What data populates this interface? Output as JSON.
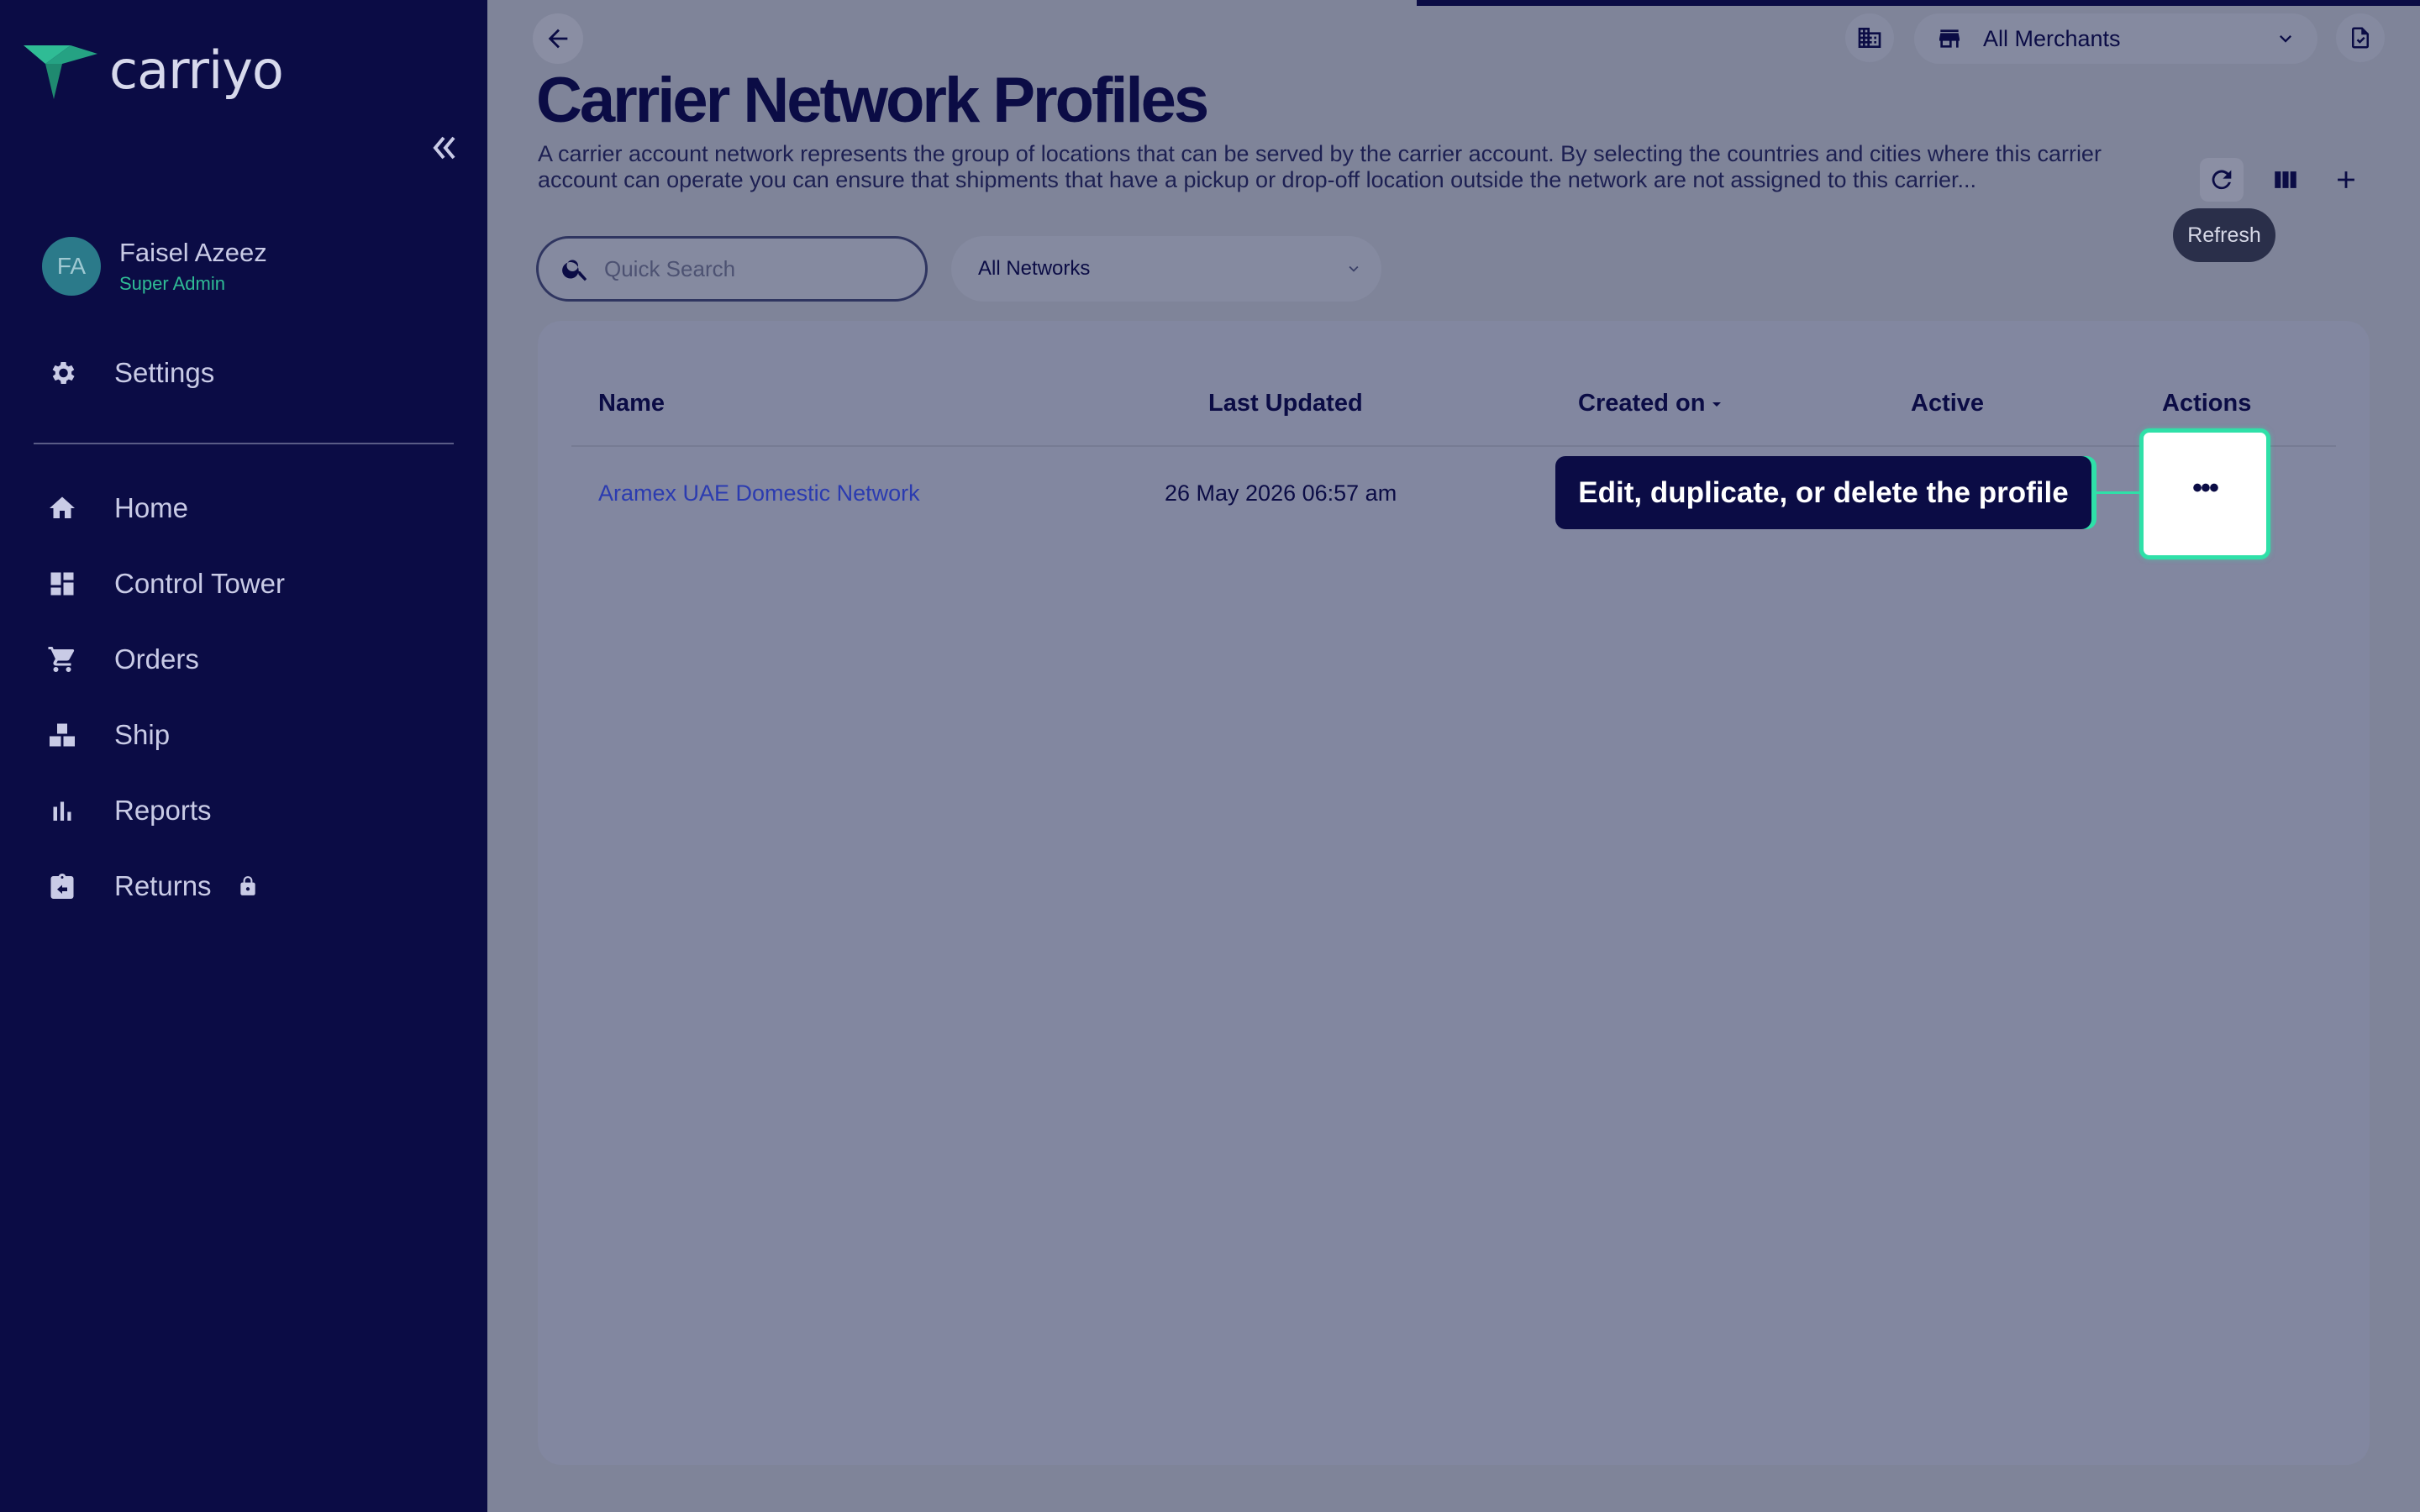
{
  "app": {
    "logo_text": "carriyo"
  },
  "user": {
    "initials": "FA",
    "name": "Faisel Azeez",
    "role": "Super Admin"
  },
  "sidebar": {
    "settings_label": "Settings",
    "items": [
      {
        "label": "Home",
        "icon": "home-icon"
      },
      {
        "label": "Control Tower",
        "icon": "dashboard-icon"
      },
      {
        "label": "Orders",
        "icon": "cart-icon"
      },
      {
        "label": "Ship",
        "icon": "ship-icon"
      },
      {
        "label": "Reports",
        "icon": "bar-chart-icon"
      },
      {
        "label": "Returns",
        "icon": "returns-icon",
        "locked": true
      }
    ]
  },
  "header": {
    "merchant_select": "All Merchants"
  },
  "page": {
    "title": "Carrier Network Profiles",
    "description": "A carrier account network represents the group of locations that can be served by the carrier account. By selecting the countries and cities where this carrier account can operate you can ensure that shipments that have a pickup or drop-off location outside the network are not assigned to this carrier..."
  },
  "toolbar": {
    "refresh_tooltip": "Refresh"
  },
  "filters": {
    "search_placeholder": "Quick Search",
    "network_select": "All Networks"
  },
  "table": {
    "columns": [
      "Name",
      "Last Updated",
      "Created on",
      "Active",
      "Actions"
    ],
    "rows": [
      {
        "name": "Aramex UAE Domestic Network",
        "last_updated": "26 May 2026 06:57 am"
      }
    ]
  },
  "callout": {
    "text": "Edit, duplicate, or delete the profile"
  },
  "colors": {
    "sidebar_bg": "#0b0c45",
    "accent": "#2fe0a8",
    "link": "#2b3bb0"
  }
}
